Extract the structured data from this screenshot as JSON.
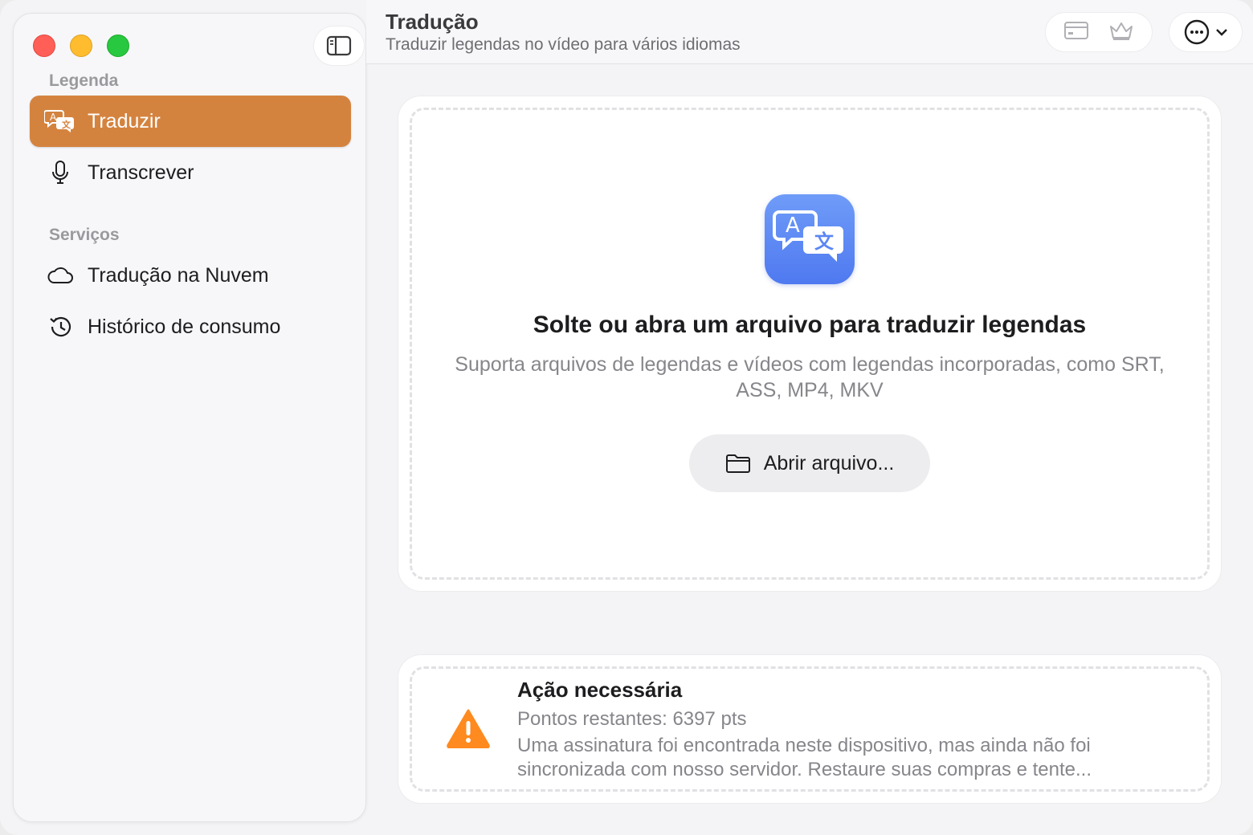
{
  "sidebar": {
    "section_legenda": "Legenda",
    "section_servicos": "Serviços",
    "items": [
      {
        "label": "Traduzir",
        "icon": "translate-icon",
        "active": true
      },
      {
        "label": "Transcrever",
        "icon": "microphone-icon",
        "active": false
      },
      {
        "label": "Tradução na Nuvem",
        "icon": "cloud-icon",
        "active": false
      },
      {
        "label": "Histórico de consumo",
        "icon": "history-icon",
        "active": false
      }
    ]
  },
  "header": {
    "title": "Tradução",
    "subtitle": "Traduzir legendas no vídeo para vários idiomas"
  },
  "dropzone": {
    "title": "Solte ou abra um arquivo para traduzir legendas",
    "description": "Suporta arquivos de legendas e vídeos com legendas incorporadas, como SRT, ASS, MP4, MKV",
    "open_button": "Abrir arquivo..."
  },
  "alert": {
    "title": "Ação necessária",
    "points": "Pontos restantes: 6397 pts",
    "message": "Uma assinatura foi encontrada neste dispositivo, mas ainda não foi sincronizada com nosso servidor. Restaure suas compras e tente..."
  },
  "colors": {
    "accent": "#d4833f",
    "app_icon": "#5b86f4",
    "warning": "#ff8a1f"
  }
}
